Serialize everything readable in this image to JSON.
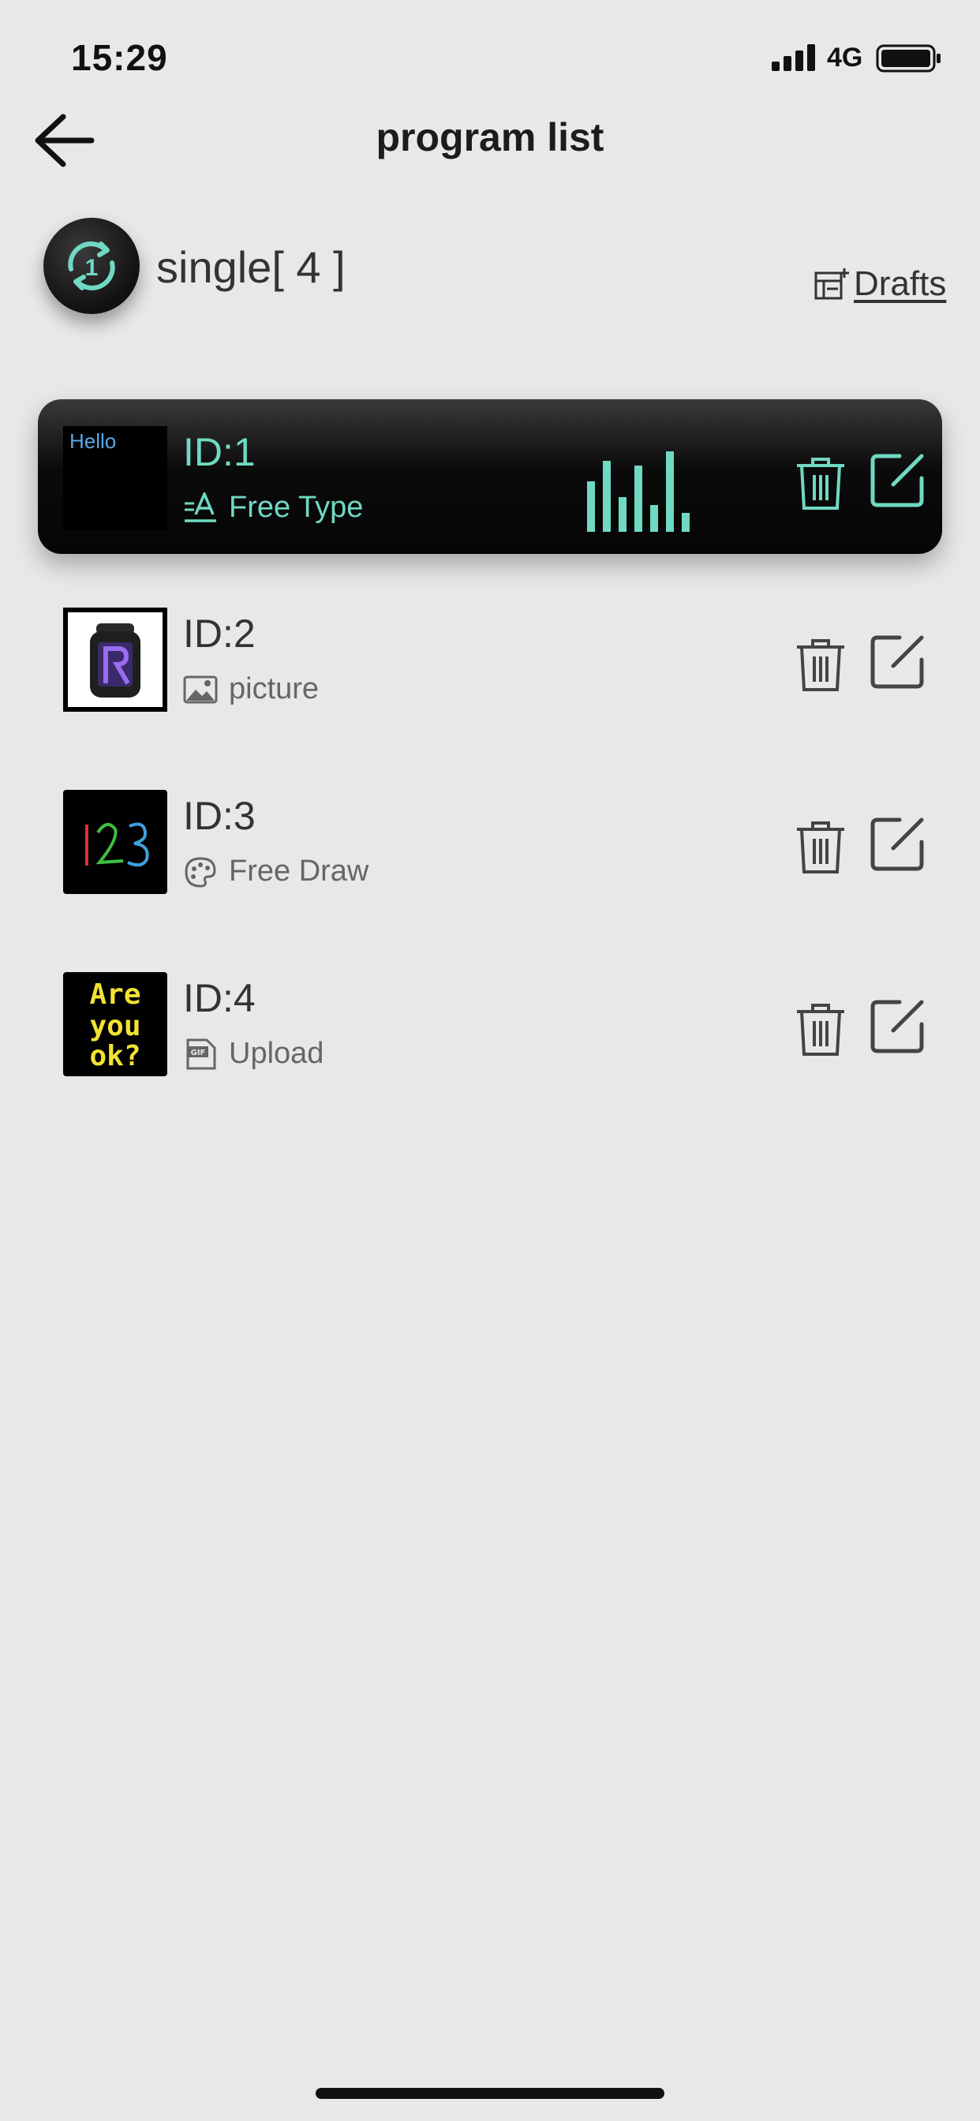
{
  "status_bar": {
    "time": "15:29",
    "network": "4G"
  },
  "header": {
    "title": "program list"
  },
  "mode": {
    "label": "single[ 4 ]",
    "icon": "single-loop-icon"
  },
  "drafts": {
    "label": "Drafts"
  },
  "programs": [
    {
      "id_label": "ID:1",
      "type": "Free Type",
      "type_icon": "text-type-icon",
      "thumb_text": "Hello",
      "active": true
    },
    {
      "id_label": "ID:2",
      "type": "picture",
      "type_icon": "image-icon",
      "active": false
    },
    {
      "id_label": "ID:3",
      "type": "Free Draw",
      "type_icon": "palette-icon",
      "thumb_text": "123",
      "active": false
    },
    {
      "id_label": "ID:4",
      "type": "Upload",
      "type_icon": "gif-icon",
      "thumb_lines": [
        "Are",
        "you",
        "ok?"
      ],
      "active": false
    }
  ],
  "colors": {
    "accent": "#6fd9c3",
    "background": "#e8e8e8",
    "active_row": "#0b0b0b",
    "thumb_text_yellow": "#f2e233"
  }
}
